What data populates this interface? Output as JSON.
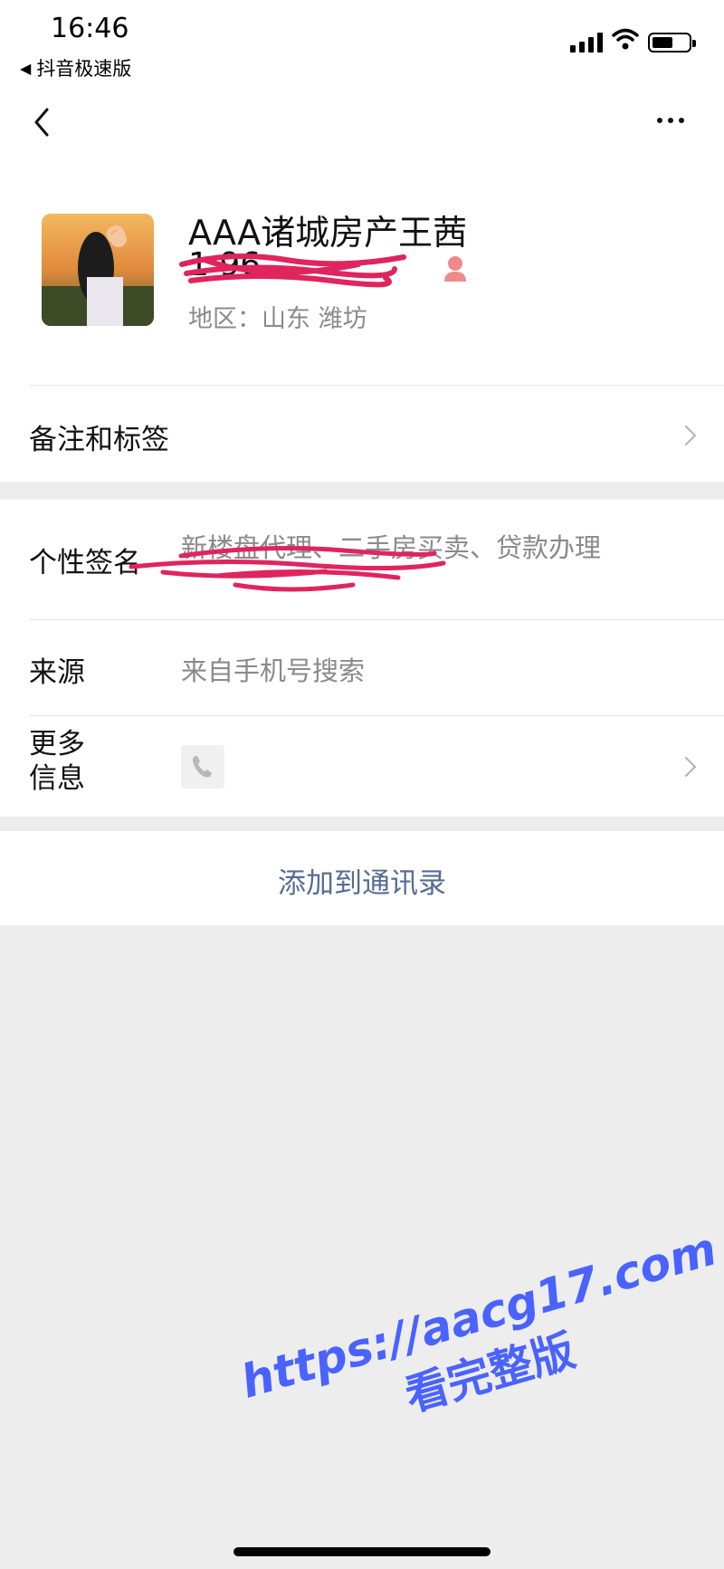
{
  "status_bar": {
    "time": "16:46",
    "back_app": "抖音极速版",
    "back_arrow": "◀"
  },
  "nav": {
    "back_icon": "chevron-left-icon",
    "more_icon": "more-horizontal-icon"
  },
  "profile": {
    "name": "AAA诸城房产王茜",
    "wechat_id_visible": "1          96",
    "region": "地区：山东 潍坊"
  },
  "rows": {
    "remark": {
      "label": "备注和标签"
    },
    "signature": {
      "label": "个性签名",
      "value": "新楼盘代理、二手房买卖、贷款办理"
    },
    "source": {
      "label": "来源",
      "value": "来自手机号搜索"
    },
    "more_info": {
      "label_line1": "更多",
      "label_line2": "信息",
      "icon": "phone-icon"
    }
  },
  "actions": {
    "add_contact": "添加到通讯录"
  },
  "watermark": {
    "line1": "https://aacg17.com",
    "line2": "看完整版"
  },
  "colors": {
    "link_blue": "#576b95",
    "watermark_blue": "#4a63ff",
    "redaction_pink": "#e0245e",
    "background": "#ededed"
  }
}
